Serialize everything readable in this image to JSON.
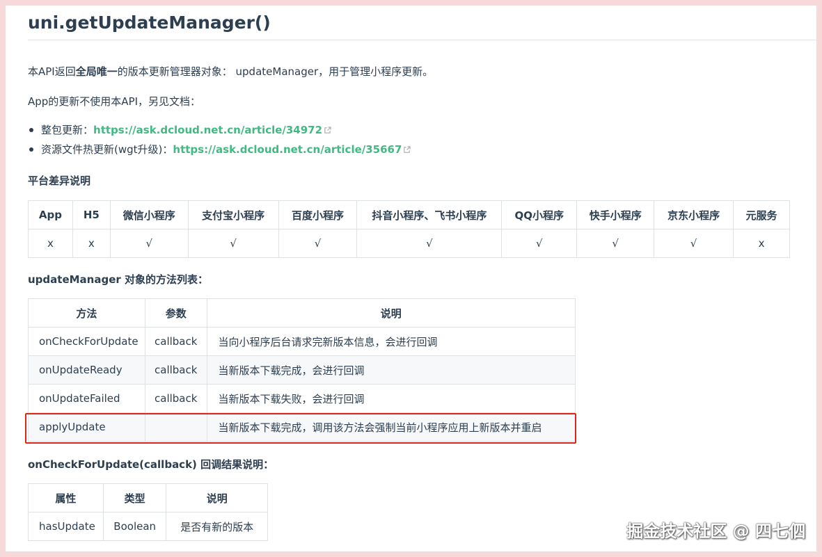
{
  "title": "uni.getUpdateManager()",
  "intro": {
    "prefix": "本API返回",
    "bold": "全局唯一",
    "suffix": "的版本更新管理器对象： updateManager，用于管理小程序更新。"
  },
  "app_note": "App的更新不使用本API，另见文档：",
  "links": [
    {
      "label": "整包更新：",
      "url": "https://ask.dcloud.net.cn/article/34972"
    },
    {
      "label": "资源文件热更新(wgt升级)：",
      "url": "https://ask.dcloud.net.cn/article/35667"
    }
  ],
  "platform_heading": "平台差异说明",
  "platform_table": {
    "headers": [
      "App",
      "H5",
      "微信小程序",
      "支付宝小程序",
      "百度小程序",
      "抖音小程序、飞书小程序",
      "QQ小程序",
      "快手小程序",
      "京东小程序",
      "元服务"
    ],
    "values": [
      "x",
      "x",
      "√",
      "√",
      "√",
      "√",
      "√",
      "√",
      "√",
      "x"
    ]
  },
  "methods_heading": "updateManager 对象的方法列表：",
  "methods_table": {
    "headers": [
      "方法",
      "参数",
      "说明"
    ],
    "rows": [
      [
        "onCheckForUpdate",
        "callback",
        "当向小程序后台请求完新版本信息，会进行回调"
      ],
      [
        "onUpdateReady",
        "callback",
        "当新版本下载完成，会进行回调"
      ],
      [
        "onUpdateFailed",
        "callback",
        "当新版本下载失败，会进行回调"
      ],
      [
        "applyUpdate",
        "",
        "当新版本下载完成，调用该方法会强制当前小程序应用上新版本并重启"
      ]
    ]
  },
  "callback_heading": "onCheckForUpdate(callback) 回调结果说明：",
  "callback_table": {
    "headers": [
      "属性",
      "类型",
      "说明"
    ],
    "rows": [
      [
        "hasUpdate",
        "Boolean",
        "是否有新的版本"
      ]
    ]
  },
  "watermark": "掘金技术社区 @ 四七伵",
  "colors": {
    "link": "#42b983",
    "highlight": "#d9261c",
    "stripe": "#f6f8fa"
  }
}
